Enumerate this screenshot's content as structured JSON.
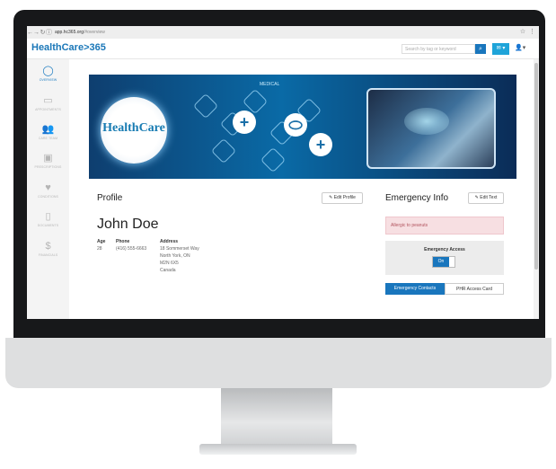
{
  "browser": {
    "url_host": "app.hc365.org",
    "url_path": "/#overview",
    "star_icon": "star-icon",
    "menu_icon": "kebab-icon"
  },
  "header": {
    "logo": "HealthCare>365",
    "search_placeholder": "Search by tag or keyword",
    "brand_color": "#1976bd"
  },
  "sidebar": {
    "items": [
      {
        "label": "OVERVIEW",
        "icon": "circle-icon",
        "active": true
      },
      {
        "label": "APPOINTMENTS",
        "icon": "calendar-icon",
        "active": false
      },
      {
        "label": "CARE TEAM",
        "icon": "team-icon",
        "active": false
      },
      {
        "label": "PRESCRIPTIONS",
        "icon": "prescription-icon",
        "active": false
      },
      {
        "label": "CONDITIONS",
        "icon": "heart-icon",
        "active": false
      },
      {
        "label": "DOCUMENTS",
        "icon": "document-icon",
        "active": false
      },
      {
        "label": "FINANCIALS",
        "icon": "dollar-icon",
        "active": false
      }
    ]
  },
  "banner": {
    "brand_text": "HealthCare",
    "hex_label": "MEDICAL"
  },
  "profile": {
    "title": "Profile",
    "edit_label": "Edit Profile",
    "name": "John Doe",
    "age_label": "Age",
    "age": "28",
    "phone_label": "Phone",
    "phone": "(416) 555-6663",
    "address_label": "Address",
    "address_lines": [
      "18 Sommerset Way",
      "North York, ON",
      "M2N 6X5",
      "Canada"
    ]
  },
  "emergency": {
    "title": "Emergency Info",
    "edit_label": "Edit Text",
    "allergy": "Allergic to peanuts",
    "access_label": "Emergency Access",
    "toggle_label": "On",
    "tabs": [
      "Emergency Contacts",
      "PHR Access Card"
    ]
  }
}
